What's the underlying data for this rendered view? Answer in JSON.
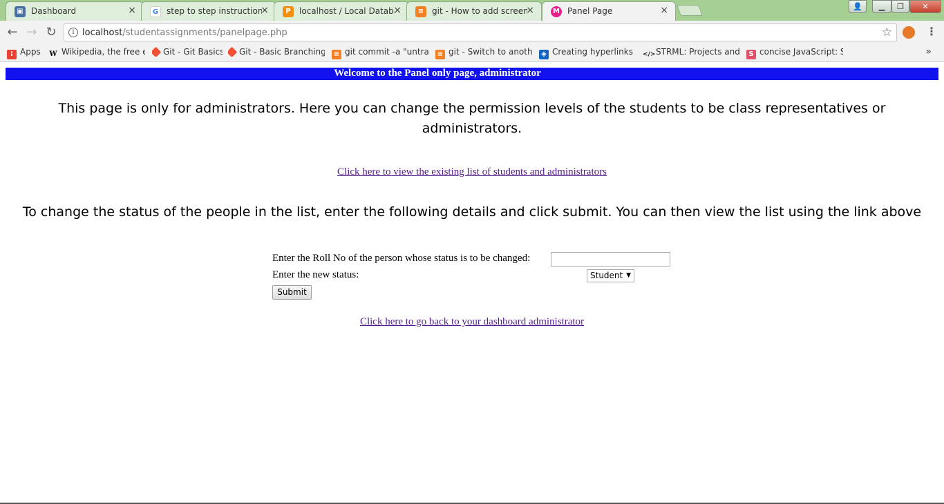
{
  "browser": {
    "tabs": [
      {
        "title": "Dashboard",
        "icon": "dashboard-icon",
        "icon_color": "#4a6fa5",
        "active": false
      },
      {
        "title": "step to step instructions",
        "icon": "google-icon",
        "icon_color": "#4285f4",
        "active": false
      },
      {
        "title": "localhost / Local Databa",
        "icon": "phpmyadmin-icon",
        "icon_color": "#f29111",
        "active": false
      },
      {
        "title": "git - How to add screens",
        "icon": "stackoverflow-icon",
        "icon_color": "#f48024",
        "active": false
      },
      {
        "title": "Panel Page",
        "icon": "page-icon",
        "icon_color": "#e91e8c",
        "active": true
      }
    ],
    "tab_close_glyph": "×",
    "url_host": "localhost",
    "url_path": "/studentassignments/panelpage.php",
    "bookmarks": [
      {
        "label": "Apps",
        "icon": "apps-icon",
        "color": "#e94235"
      },
      {
        "label": "Wikipedia, the free en",
        "icon": "wikipedia-icon",
        "color": "#000000"
      },
      {
        "label": "Git - Git Basics",
        "icon": "git-icon",
        "color": "#f05033"
      },
      {
        "label": "Git - Basic Branching a",
        "icon": "git-icon",
        "color": "#f05033"
      },
      {
        "label": "git commit -a \"untrac",
        "icon": "stackoverflow-icon",
        "color": "#f48024"
      },
      {
        "label": "git - Switch to anothe",
        "icon": "stackoverflow-icon",
        "color": "#f48024"
      },
      {
        "label": "Creating hyperlinks - t",
        "icon": "hyperlink-icon",
        "color": "#1565c0"
      },
      {
        "label": "STRML: Projects and W",
        "icon": "code-icon",
        "color": "#222222"
      },
      {
        "label": "concise JavaScript: Sli",
        "icon": "slides-icon",
        "color": "#e0506a"
      }
    ],
    "more_glyph": "»"
  },
  "page": {
    "banner": "Welcome to the Panel only page, administrator",
    "intro": "This page is only for administrators. Here you can change the permission levels of the students to be class representatives or administrators.",
    "view_list_link": "Click here to view the existing list of students and administrators",
    "instruction": "To change the status of the people in the list, enter the following details and click submit. You can then view the list using the link above",
    "form": {
      "roll_label": "Enter the Roll No of the person whose status is to be changed:",
      "roll_value": "",
      "status_label": "Enter the new status:",
      "status_selected": "Student",
      "submit_label": "Submit"
    },
    "back_link": "Click here to go back to your dashboard administrator"
  },
  "colors": {
    "banner_bg": "#1212ee",
    "link": "#551a8b",
    "tabstrip": "#a6cf94"
  }
}
